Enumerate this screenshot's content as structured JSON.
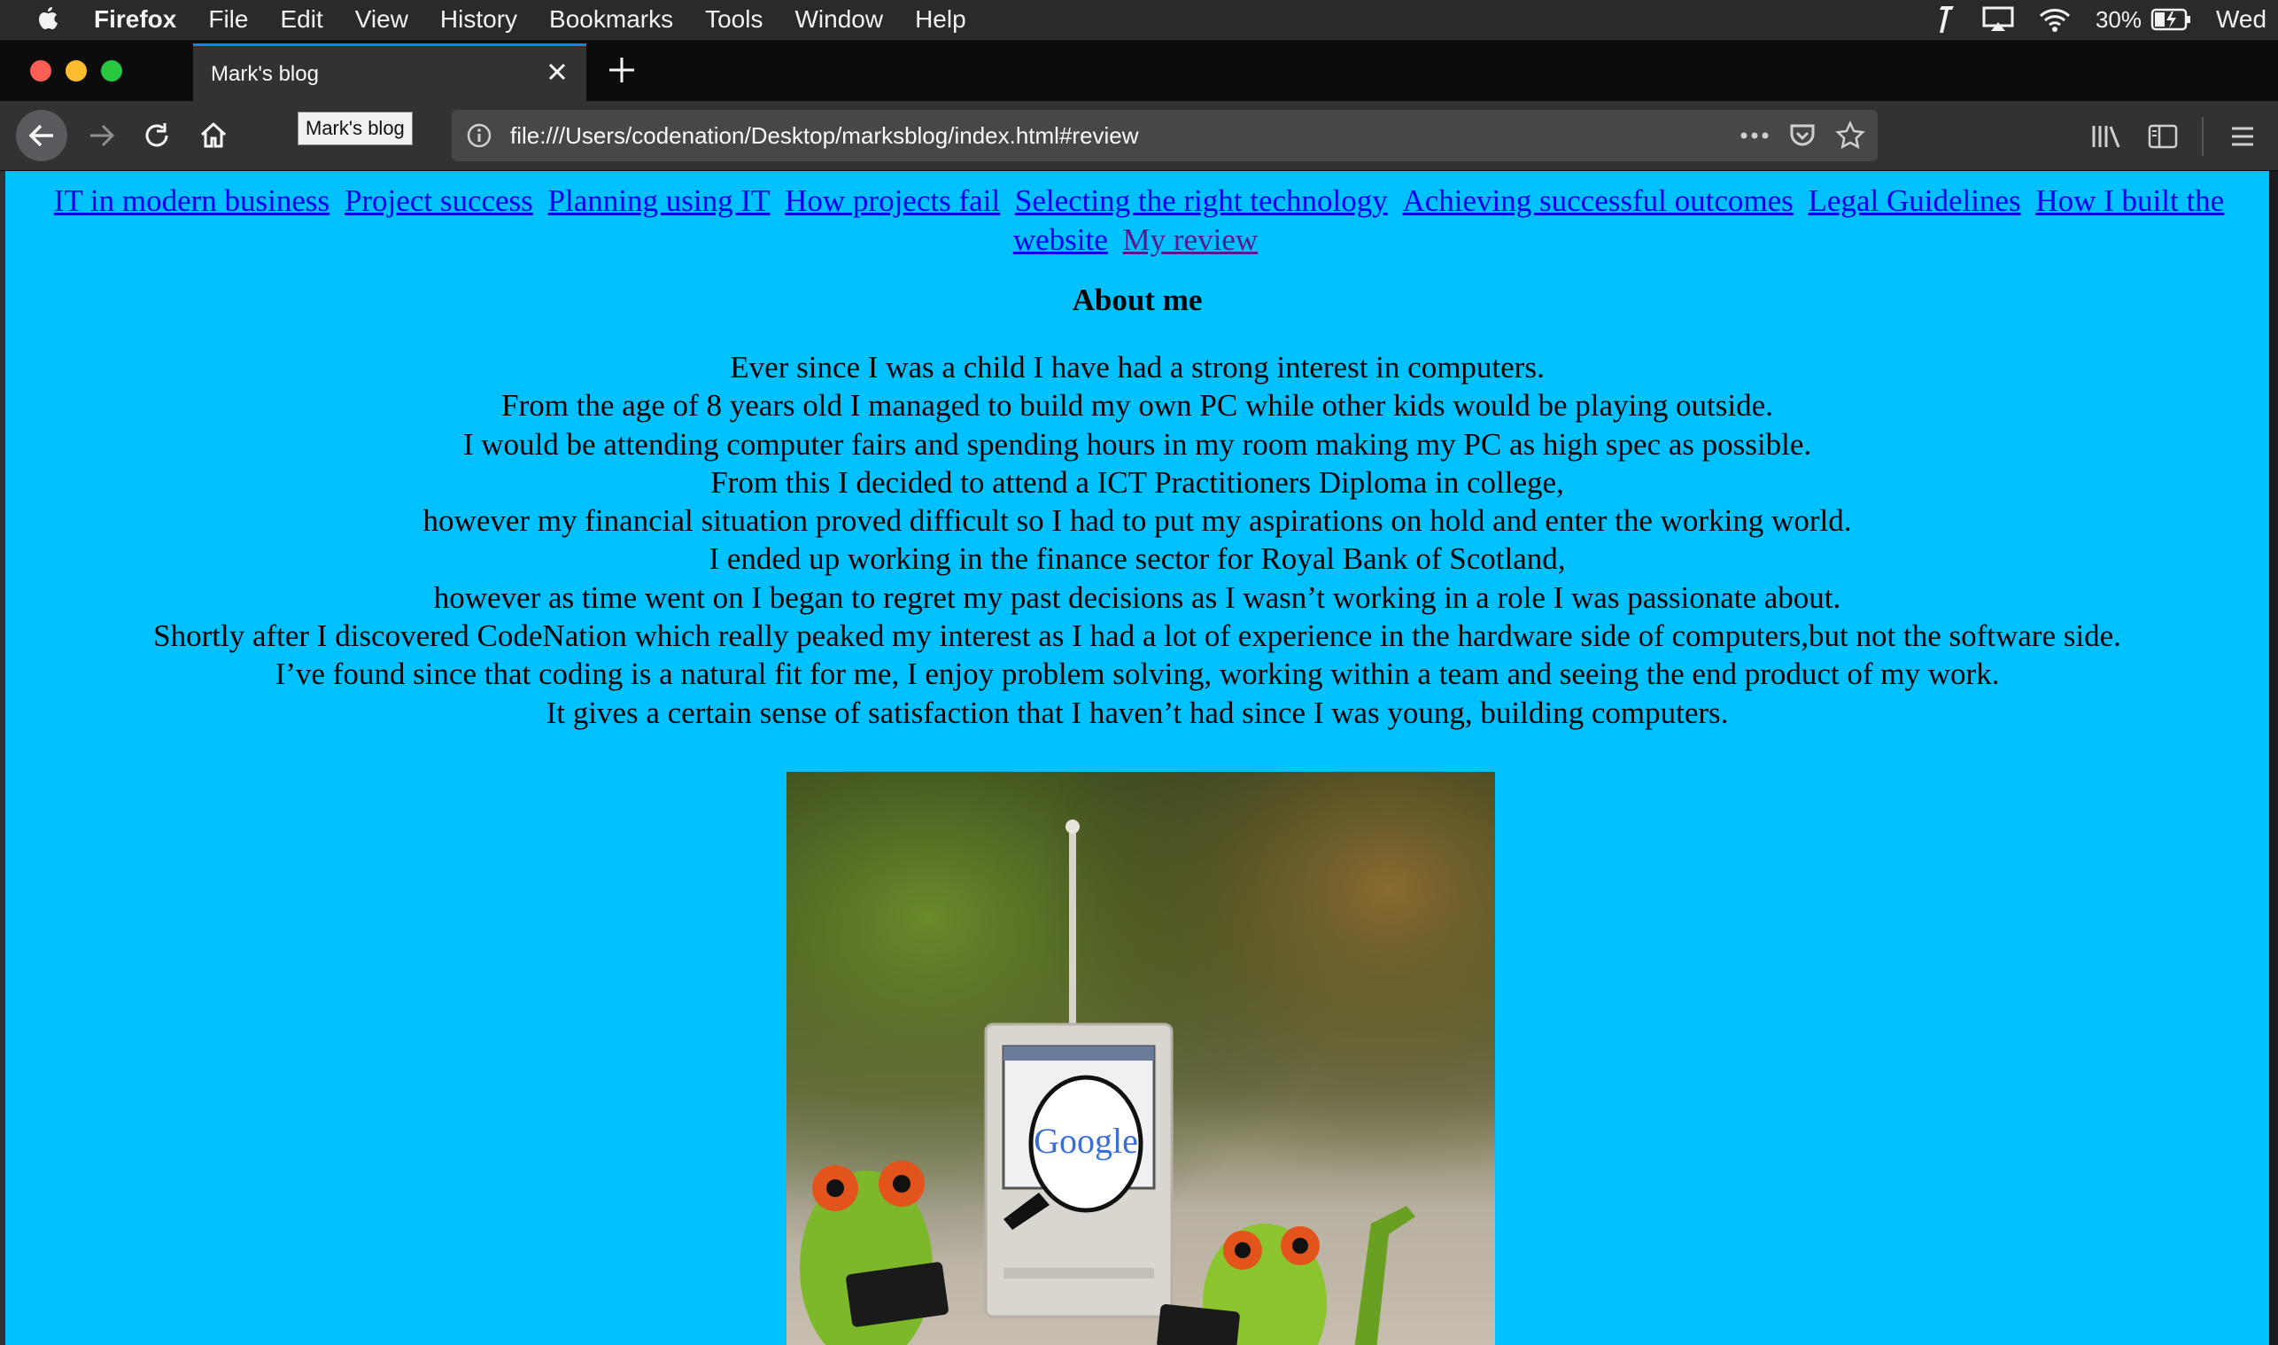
{
  "menubar": {
    "app_name": "Firefox",
    "items": [
      "File",
      "Edit",
      "View",
      "History",
      "Bookmarks",
      "Tools",
      "Window",
      "Help"
    ],
    "battery": "30%",
    "clock": "Wed"
  },
  "tab": {
    "title": "Mark's blog"
  },
  "navbar": {
    "tooltip": "Mark's blog",
    "url": "file:///Users/codenation/Desktop/marksblog/index.html#review"
  },
  "page": {
    "links": [
      "IT in modern business",
      "Project success",
      "Planning using IT",
      "How projects fail",
      "Selecting the right technology",
      "Achieving successful outcomes",
      "Legal Guidelines",
      "How I built the website",
      "My review"
    ],
    "heading": "About me",
    "paragraph_lines": [
      "Ever since I was a child I have had a strong interest in computers.",
      "From the age of 8 years old I managed to build my own PC while other kids would be playing outside.",
      "I would be attending computer fairs and spending hours in my room making my PC as high spec as possible.",
      "From this I decided to attend a ICT Practitioners Diploma in college,",
      "however my financial situation proved difficult so I had to put my aspirations on hold and enter the working world.",
      "I ended up working in the finance sector for Royal Bank of Scotland,",
      "however as time went on I began to regret my past decisions as I wasn’t working in a role I was passionate about.",
      "Shortly after I discovered CodeNation which really peaked my interest as I had a lot of experience in the hardware side of computers,but not the software side.",
      "I’ve found since that coding is a natural fit for me, I enjoy problem solving, working within a team and seeing the end product of my work.",
      "It gives a certain sense of satisfaction that I haven’t had since I was young, building computers."
    ],
    "image_screen_text": "Google"
  },
  "colors": {
    "page_background": "#00c1ff",
    "link": "#0000ee",
    "visited_link": "#551a8b",
    "tab_accent": "#0a84ff"
  }
}
